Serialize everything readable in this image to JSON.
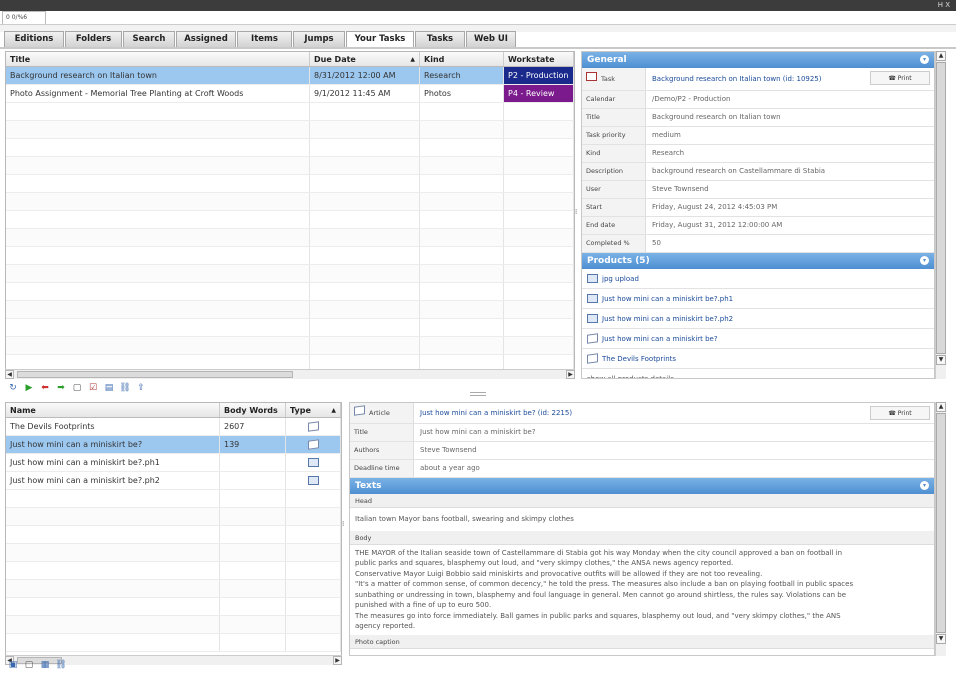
{
  "window": {
    "app_tab": "0 0/%6",
    "controls": "H X"
  },
  "tabs": [
    "Editions",
    "Folders",
    "Search",
    "Assigned",
    "Items",
    "Jumps",
    "Your Tasks",
    "Tasks",
    "Web UI"
  ],
  "active_tab": "Your Tasks",
  "tasks_grid": {
    "columns": [
      "Title",
      "Due Date",
      "Kind",
      "Workstate"
    ],
    "sort_indicator": "▲",
    "rows": [
      {
        "title": "Background research on Italian town",
        "due": "8/31/2012 12:00 AM",
        "kind": "Research",
        "workstate": "P2 - Production"
      },
      {
        "title": "Photo Assignment - Memorial Tree Planting at Croft Woods",
        "due": "9/1/2012 11:45 AM",
        "kind": "Photos",
        "workstate": "P4 - Review"
      }
    ]
  },
  "general": {
    "header": "General",
    "task_label": "Task",
    "task_value": "Background research on Italian town (id: 10925)",
    "print_label": "Print",
    "fields": [
      {
        "label": "Calendar",
        "value": "/Demo/P2 - Production"
      },
      {
        "label": "Title",
        "value": "Background research on Italian town"
      },
      {
        "label": "Task priority",
        "value": "medium"
      },
      {
        "label": "Kind",
        "value": "Research"
      },
      {
        "label": "Description",
        "value": "background research on Castellammare di Stabia"
      },
      {
        "label": "User",
        "value": "Steve Townsend"
      },
      {
        "label": "Start",
        "value": "Friday, August 24, 2012 4:45:03 PM"
      },
      {
        "label": "End date",
        "value": "Friday, August 31, 2012 12:00:00 AM"
      },
      {
        "label": "Completed %",
        "value": "50"
      }
    ]
  },
  "products": {
    "header": "Products (5)",
    "items": [
      "jpg upload",
      "Just how mini can a miniskirt be?.ph1",
      "Just how mini can a miniskirt be?.ph2",
      "Just how mini can a miniskirt be?",
      "The Devils Footprints"
    ],
    "footer_link": "show all products details"
  },
  "items_grid": {
    "columns": [
      "Name",
      "Body Words",
      "Type"
    ],
    "sort_indicator": "▲",
    "rows": [
      {
        "name": "The Devils Footprints",
        "words": "2607",
        "type": "article"
      },
      {
        "name": "Just how mini can a miniskirt be?",
        "words": "139",
        "type": "article"
      },
      {
        "name": "Just how mini can a miniskirt be?.ph1",
        "words": "",
        "type": "photo"
      },
      {
        "name": "Just how mini can a miniskirt be?.ph2",
        "words": "",
        "type": "photo"
      }
    ]
  },
  "article": {
    "article_label": "Article",
    "article_value": "Just how mini can a miniskirt be? (id: 2215)",
    "print_label": "Print",
    "fields": [
      {
        "label": "Title",
        "value": "Just how mini can a miniskirt be?"
      },
      {
        "label": "Authors",
        "value": "Steve Townsend"
      },
      {
        "label": "Deadline time",
        "value": "about a year ago"
      }
    ],
    "texts_header": "Texts",
    "head_label": "Head",
    "head_text": "Italian town Mayor bans football, swearing and skimpy clothes",
    "body_label": "Body",
    "body_lines": [
      "THE MAYOR of the Italian seaside town of Castellammare di Stabia got his way Monday when the city council approved a ban on football in",
      "public parks and squares, blasphemy out loud, and \"very skimpy clothes,\" the ANSA news agency reported.",
      "Conservative Mayor Luigi Bobbio said miniskirts and provocative outfits will be allowed if they are not too revealing.",
      "\"It's a matter of common sense, of common decency,\" he told the press. The measures also include a ban on playing football in public spaces",
      "sunbathing or undressing in town, blasphemy and foul language in general. Men cannot go around shirtless, the rules say. Violations can be",
      "punished with a fine of up to euro 500.",
      "The measures go into force immediately. Ball games in public parks and squares, blasphemy out loud, and \"very skimpy clothes,\" the ANS",
      "agency reported."
    ],
    "caption_label": "Photo caption"
  },
  "colors": {
    "header_blue": "#4e8fd2",
    "selected_row": "#9cc7ef",
    "production": "#1a2a8c",
    "review": "#7a1a8c"
  }
}
